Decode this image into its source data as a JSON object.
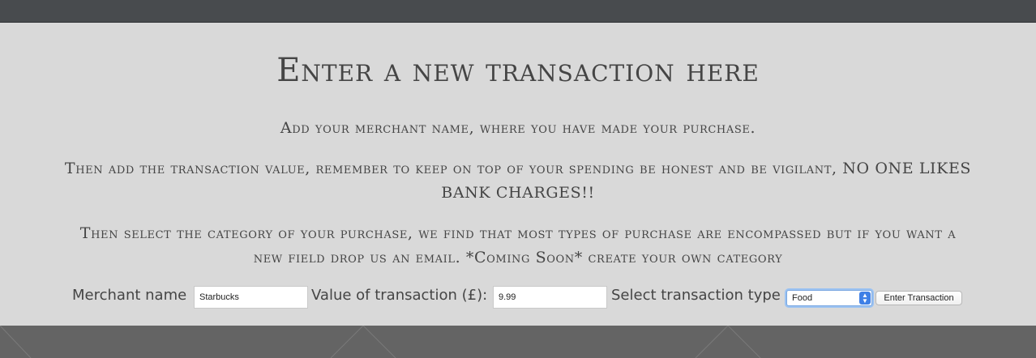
{
  "heading": "Enter a new transaction here",
  "paragraphs": {
    "p1": "Add your merchant name, where you have made your purchase.",
    "p2a": "Then add the transaction value, remember to keep on top of your spending be honest and be vigilant, NO ONE LIKES",
    "p2b": "BANK CHARGES!!",
    "p3a": "Then select the category of your purchase, we find that most types of purchase are encompassed but if you want a",
    "p3b": "new field drop us an email. *Coming Soon* create your own category"
  },
  "form": {
    "merchant_label": "Merchant name",
    "merchant_value": "Starbucks",
    "value_label": "Value of transaction (£):",
    "value_value": "9.99",
    "type_label": "Select transaction type",
    "type_selected": "Food",
    "submit_label": "Enter Transaction"
  },
  "colors": {
    "topbar": "#484b4e",
    "panel": "#d9d9d9",
    "footer": "#646464",
    "text": "#454545",
    "select_accent": "#3f80e6"
  }
}
